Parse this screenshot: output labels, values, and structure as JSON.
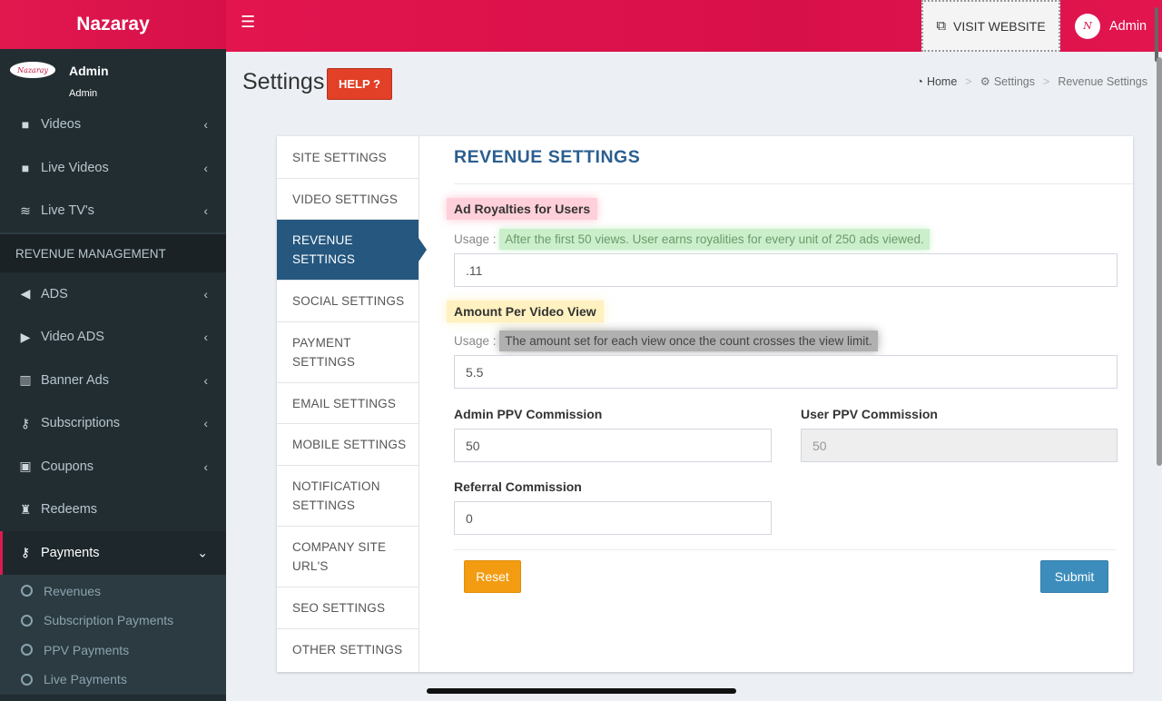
{
  "app": {
    "brand": "Nazaray"
  },
  "sidebar": {
    "user": {
      "avatar_text": "Nazaray",
      "name": "Admin",
      "role": "Admin"
    },
    "items": [
      {
        "label": "Videos",
        "icon": "video-camera-icon"
      },
      {
        "label": "Live Videos",
        "icon": "video-camera-icon"
      },
      {
        "label": "Live TV's",
        "icon": "wifi-icon"
      }
    ],
    "section_header": "REVENUE MANAGEMENT",
    "items2": [
      {
        "label": "ADS",
        "icon": "bullhorn-icon"
      },
      {
        "label": "Video ADS",
        "icon": "play-icon"
      },
      {
        "label": "Banner Ads",
        "icon": "bank-icon"
      },
      {
        "label": "Subscriptions",
        "icon": "key-icon"
      },
      {
        "label": "Coupons",
        "icon": "gift-icon"
      },
      {
        "label": "Redeems",
        "icon": "trophy-icon"
      }
    ],
    "active_item": {
      "label": "Payments",
      "icon": "key-icon"
    },
    "submenu": [
      "Revenues",
      "Subscription Payments",
      "PPV Payments",
      "Live Payments"
    ]
  },
  "topbar": {
    "visit_label": "VISIT WEBSITE",
    "admin_label": "Admin"
  },
  "header": {
    "title": "Settings",
    "help_label": "HELP ?",
    "breadcrumb": [
      "Home",
      "Settings",
      "Revenue Settings"
    ]
  },
  "tabs": [
    "SITE SETTINGS",
    "VIDEO SETTINGS",
    "REVENUE SETTINGS",
    "SOCIAL SETTINGS",
    "PAYMENT SETTINGS",
    "EMAIL SETTINGS",
    "MOBILE SETTINGS",
    "NOTIFICATION SETTINGS",
    "COMPANY SITE URL'S",
    "SEO SETTINGS",
    "OTHER SETTINGS"
  ],
  "form": {
    "title": "REVENUE SETTINGS",
    "ad_royalties": {
      "label": "Ad Royalties for Users",
      "usage_prefix": "Usage : ",
      "usage_text": "After the first 50 views. User earns royalities for every unit of 250 ads viewed.",
      "value": ".11"
    },
    "amount_per_view": {
      "label": "Amount Per Video View",
      "usage_prefix": "Usage : ",
      "usage_text": "The amount set for each view once the count crosses the view limit.",
      "value": "5.5"
    },
    "admin_ppv": {
      "label": "Admin PPV Commission",
      "value": "50"
    },
    "user_ppv": {
      "label": "User PPV Commission",
      "value": "50"
    },
    "referral": {
      "label": "Referral Commission",
      "value": "0"
    },
    "reset_label": "Reset",
    "submit_label": "Submit"
  }
}
